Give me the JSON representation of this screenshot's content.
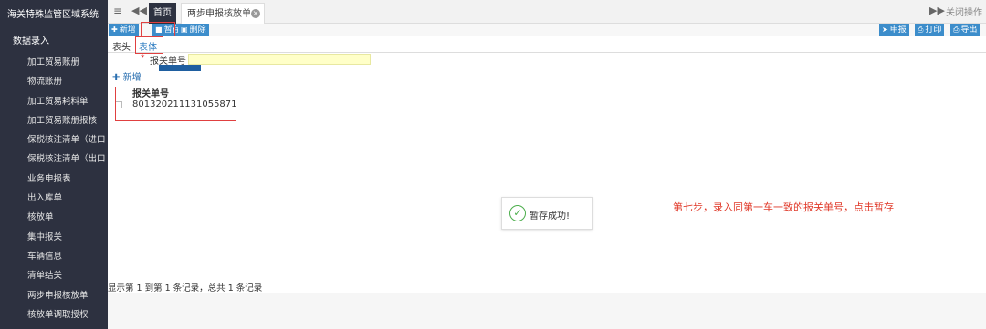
{
  "sidebar": {
    "system_title": "海关特殊监管区域系统",
    "group_label": "数据录入",
    "items": [
      "加工贸易账册",
      "物流账册",
      "加工贸易耗料单",
      "加工贸易账册报核",
      "保税核注清单（进口",
      "保税核注清单（出口",
      "业务申报表",
      "出入库单",
      "核放单",
      "集中报关",
      "车辆信息",
      "清单结关",
      "两步申报核放单",
      "核放单调取授权"
    ]
  },
  "tabbar": {
    "menu_icon": "≡",
    "prev_icon": "◀◀",
    "home_tab": "首页",
    "active_tab": "两步申报核放单",
    "next_icon": "▶▶",
    "close_ops": "关闭操作"
  },
  "toolbar": {
    "new_label": "新增",
    "save_label": "暂存",
    "delete_label": "删除",
    "apply_label": "申报",
    "print_label": "打印",
    "export_label": "导出",
    "accent": "#3c8dcb"
  },
  "subtabs": {
    "header": "表头",
    "body": "表体"
  },
  "form": {
    "required_mark": "*",
    "field_label": "报关单号"
  },
  "list": {
    "add_label": "新增",
    "column_header": "报关单号",
    "rows": [
      "801320211131055871"
    ]
  },
  "toast": {
    "message": "暂存成功!"
  },
  "annotation": {
    "text": "第七步，录入同第一车一致的报关单号，点击暂存",
    "color": "#e03a2a"
  },
  "footer": {
    "record_text": "显示第 1 到第 1 条记录，总共 1 条记录"
  }
}
